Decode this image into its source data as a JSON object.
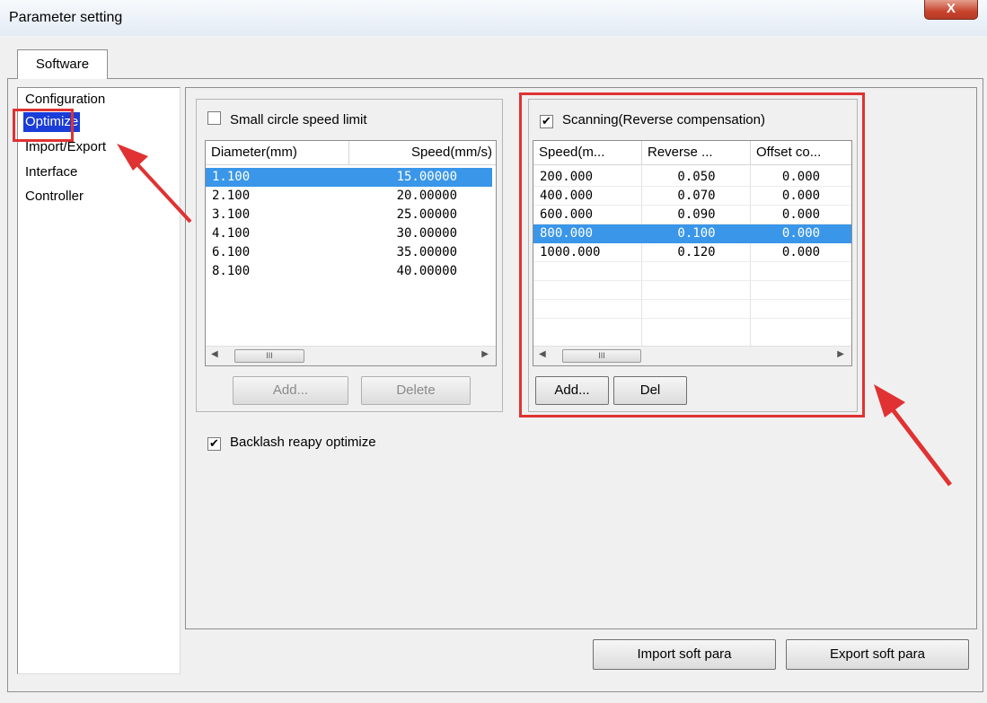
{
  "window": {
    "title": "Parameter setting",
    "close_label": "X"
  },
  "tabs": [
    {
      "label": "Software"
    }
  ],
  "nav": {
    "items": [
      {
        "label": "Configuration"
      },
      {
        "label": "Optimize"
      },
      {
        "label": "Import/Export"
      },
      {
        "label": "Interface"
      },
      {
        "label": "Controller"
      }
    ],
    "selected": "Optimize"
  },
  "small_circle": {
    "checkbox_label": "Small circle speed limit",
    "checked": false,
    "columns": [
      "Diameter(mm)",
      "Speed(mm/s)"
    ],
    "rows": [
      [
        "1.100",
        "15.00000"
      ],
      [
        "2.100",
        "20.00000"
      ],
      [
        "3.100",
        "25.00000"
      ],
      [
        "4.100",
        "30.00000"
      ],
      [
        "6.100",
        "35.00000"
      ],
      [
        "8.100",
        "40.00000"
      ]
    ],
    "selected_row": 0,
    "scroll_thumb": "III",
    "add_label": "Add...",
    "delete_label": "Delete"
  },
  "scanning": {
    "checkbox_label": "Scanning(Reverse compensation)",
    "checked": true,
    "columns": [
      "Speed(m...",
      "Reverse ...",
      "Offset co..."
    ],
    "rows": [
      [
        "200.000",
        "0.050",
        "0.000"
      ],
      [
        "400.000",
        "0.070",
        "0.000"
      ],
      [
        "600.000",
        "0.090",
        "0.000"
      ],
      [
        "800.000",
        "0.100",
        "0.000"
      ],
      [
        "1000.000",
        "0.120",
        "0.000"
      ]
    ],
    "selected_row": 3,
    "scroll_thumb": "III",
    "add_label": "Add...",
    "del_label": "Del"
  },
  "backlash": {
    "checkbox_label": "Backlash reapy optimize",
    "checked": true
  },
  "footer": {
    "import_label": "Import soft para",
    "export_label": "Export soft para"
  },
  "colors": {
    "highlight_red": "#e03232",
    "selection_blue": "#3a96e8",
    "nav_selection": "#1a3cd8"
  }
}
